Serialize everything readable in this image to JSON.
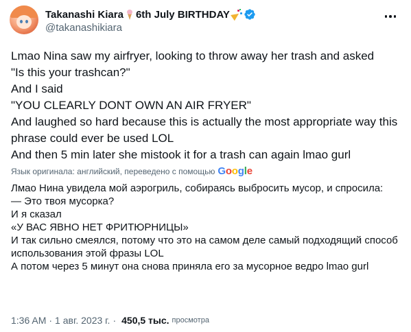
{
  "author": {
    "name": "Takanashi Kiara",
    "name_suffix": "6th July BIRTHDAY",
    "handle": "@takanashikiara",
    "emoji_icons": [
      "ice-cream-icon",
      "party-popper-icon"
    ],
    "verified": true,
    "verified_color": "#1d9bf0"
  },
  "tweet": {
    "lines": [
      "Lmao Nina saw my airfryer, looking to throw away her trash and asked",
      "\"Is this your trashcan?\"",
      "And I said",
      "\"YOU CLEARLY DONT OWN AN AIR FRYER\"",
      "And laughed so hard because this is actually the most appropriate way this phrase could ever be used LOL",
      "And then 5 min later she mistook it for a trash can again lmao gurl"
    ]
  },
  "translation": {
    "note": "Язык оригинала: английский, переведено с помощью",
    "provider": "Google",
    "lines": [
      "Лмао Нина увидела мой аэрогриль, собираясь выбросить мусор, и спросила:",
      "— Это твоя мусорка?",
      "И я сказал",
      "«У ВАС ЯВНО НЕТ ФРИТЮРНИЦЫ»",
      "И так сильно смеялся, потому что это на самом деле самый подходящий способ использования этой фразы LOL",
      "А потом через 5 минут она снова приняла его за мусорное ведро lmao gurl"
    ]
  },
  "meta": {
    "time": "1:36 AM",
    "date": "1 авг. 2023 г.",
    "views_count": "450,5 тыс.",
    "views_label": "просмотра"
  },
  "colors": {
    "text": "#0f1419",
    "secondary": "#536471",
    "verified": "#1d9bf0",
    "google_blue": "#4285f4",
    "google_red": "#ea4335",
    "google_yellow": "#fbbc05",
    "google_green": "#34a853"
  }
}
